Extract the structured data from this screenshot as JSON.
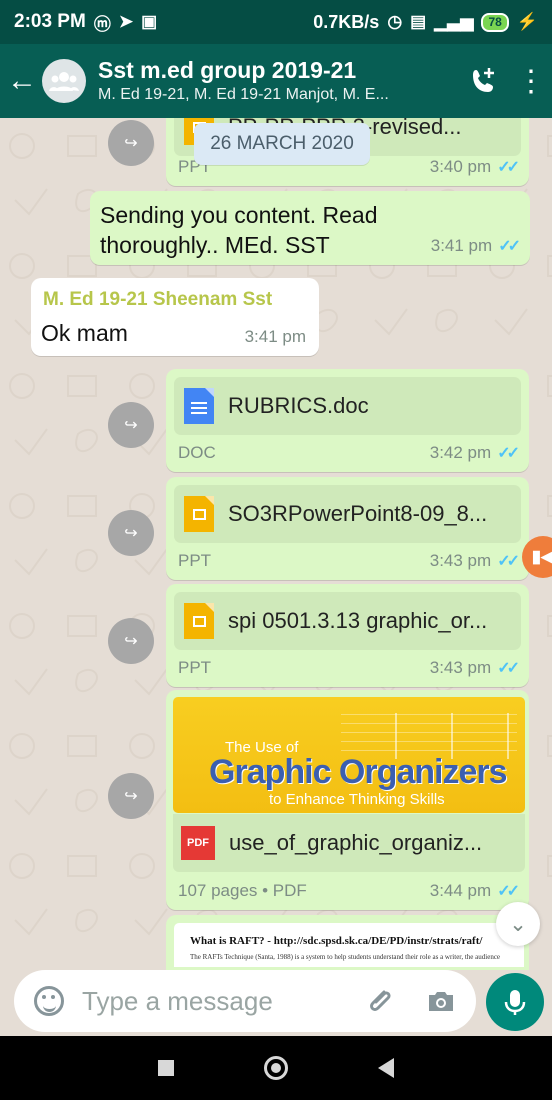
{
  "status_bar": {
    "time": "2:03 PM",
    "network_speed": "0.7KB/s",
    "battery": "78"
  },
  "header": {
    "title": "Sst m.ed group 2019-21",
    "subtitle": "M. Ed 19-21, M. Ed 19-21 Manjot, M. E..."
  },
  "chat": {
    "date_chip": "26 MARCH 2020",
    "top_partial": {
      "file_name": "PP-PP-PPR.3-revised...",
      "file_type": "PPT",
      "time": "3:40 pm"
    },
    "sent_text": {
      "text": "Sending you content. Read\nthoroughly.. MEd. SST",
      "time": "3:41 pm"
    },
    "received_text": {
      "sender": "M. Ed 19-21 Sheenam Sst",
      "text": "Ok mam",
      "time": "3:41 pm"
    },
    "files": [
      {
        "name": "RUBRICS.doc",
        "type": "DOC",
        "time": "3:42 pm",
        "icon": "doc-icon"
      },
      {
        "name": "SO3RPowerPoint8-09_8...",
        "type": "PPT",
        "time": "3:43 pm",
        "icon": "slides-icon"
      },
      {
        "name": "spi 0501.3.13 graphic_or...",
        "type": "PPT",
        "time": "3:43 pm",
        "icon": "slides-icon"
      }
    ],
    "pdf_message": {
      "preview_subtitle": "The Use of",
      "preview_title": "Graphic Organizers",
      "preview_tagline": "to Enhance Thinking Skills",
      "name": "use_of_graphic_organiz...",
      "meta": "107 pages • PDF",
      "time": "3:44 pm"
    },
    "bottom_preview": {
      "title": "What is RAFT? - http://sdc.spsd.sk.ca/DE/PD/instr/strats/raft/",
      "text": "The RAFTs Technique (Santa, 1988) is a system to help students understand their role as a writer, the audience"
    }
  },
  "composer": {
    "placeholder": "Type a message"
  },
  "colors": {
    "header": "#075e54",
    "outgoing_bubble": "#dcf8c6",
    "incoming_bubble": "#ffffff",
    "mic": "#00897b",
    "read_ticks": "#4fc3f7"
  }
}
